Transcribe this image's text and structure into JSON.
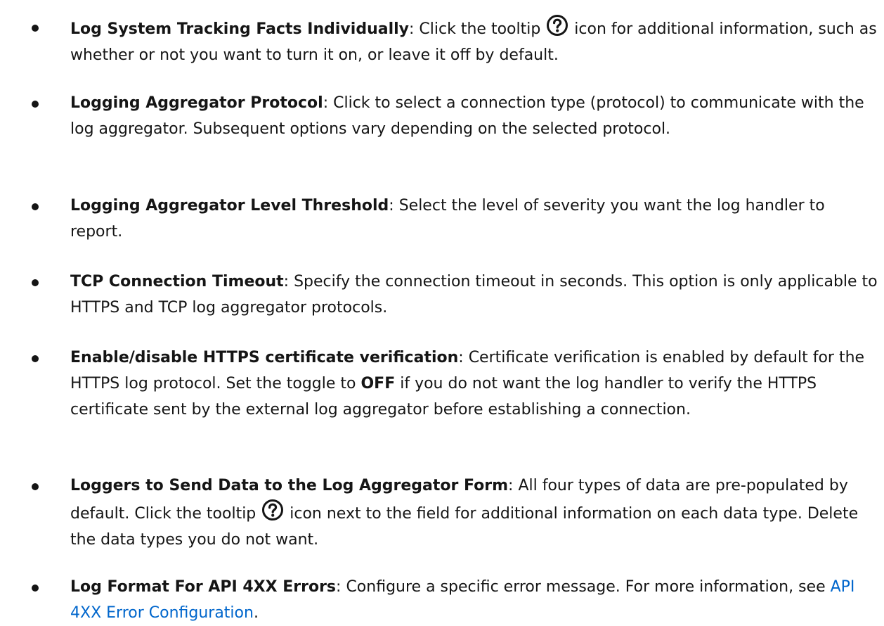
{
  "items": [
    {
      "term": "Log System Tracking Facts Individually",
      "sep": ":",
      "before_icon": " Click the tooltip ",
      "icon": "question-circle-icon",
      "after_icon": " icon for additional information, such as whether or not you want to turn it on, or leave it off by default."
    },
    {
      "term": "Logging Aggregator Protocol",
      "sep": ":",
      "text": " Click to select a connection type (protocol) to communicate with the log aggregator. Subsequent options vary depending on the selected protocol."
    },
    {
      "term": "Logging Aggregator Level Threshold",
      "sep": ":",
      "text": " Select the level of severity you want the log handler to report."
    },
    {
      "term": "TCP Connection Timeout",
      "sep": ":",
      "text": " Specify the connection timeout in seconds. This option is only applicable to HTTPS and TCP log aggregator protocols."
    },
    {
      "term": "Enable/disable HTTPS certificate verification",
      "sep": ":",
      "before_strong": " Certificate verification is enabled by default for the HTTPS log protocol. Set the toggle to ",
      "strong": "OFF",
      "after_strong": " if you do not want the log handler to verify the HTTPS certificate sent by the external log aggregator before establishing a connection."
    },
    {
      "term": "Loggers to Send Data to the Log Aggregator Form",
      "sep": ":",
      "before_icon": " All four types of data are pre-populated by default. Click the tooltip ",
      "icon": "question-circle-icon",
      "after_icon": " icon next to the field for additional information on each data type. Delete the data types you do not want."
    },
    {
      "term": "Log Format For API 4XX Errors",
      "sep": ":",
      "before_link": " Configure a specific error message. For more information, see ",
      "link": "API 4XX Error Configuration",
      "after_link": "."
    }
  ],
  "colors": {
    "text": "#151515",
    "link": "#0066cc"
  }
}
